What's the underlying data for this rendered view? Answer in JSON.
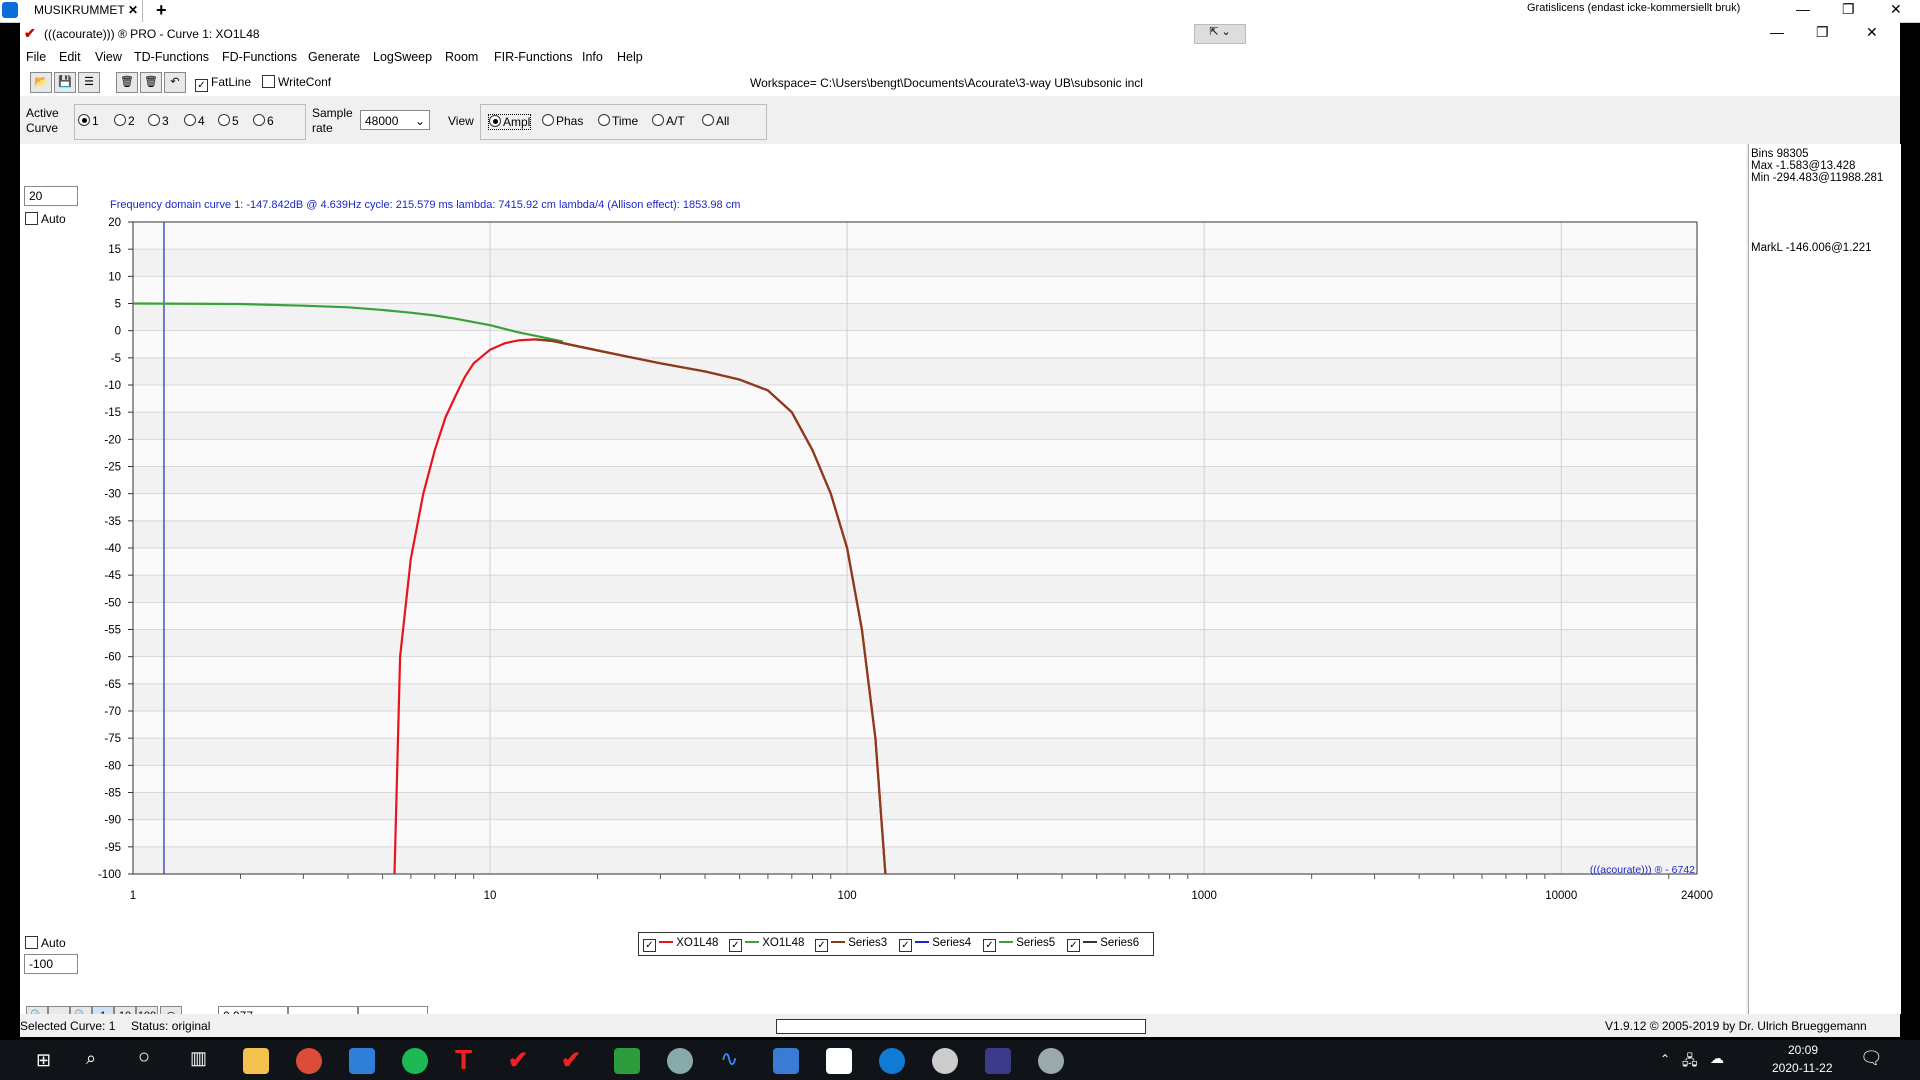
{
  "tv": {
    "tab_label": "MUSIKRUMMET",
    "license": "Gratislicens (endast icke-kommersiellt bruk)"
  },
  "app": {
    "title": "(((acourate))) ® PRO - Curve 1: XO1L48",
    "menu": [
      "File",
      "Edit",
      "View",
      "TD-Functions",
      "FD-Functions",
      "Generate",
      "LogSweep",
      "Room",
      "FIR-Functions",
      "Info",
      "Help"
    ],
    "fatline_label": "FatLine",
    "writeconf_label": "WriteConf",
    "workspace": "Workspace= C:\\Users\\bengt\\Documents\\Acourate\\3-way UB\\subsonic incl",
    "active_curve_label": "Active Curve",
    "curves": [
      "1",
      "2",
      "3",
      "4",
      "5",
      "6"
    ],
    "sample_rate_label": "Sample rate",
    "sample_rate": "48000",
    "view_label": "View",
    "views": [
      "Ampl",
      "Phas",
      "Time",
      "A/T",
      "All"
    ],
    "ymax_input": "20",
    "ymin_input": "-100",
    "auto_label": "Auto",
    "zoom_value": "0.977",
    "zoom_btns": [
      "1",
      "10",
      "100"
    ]
  },
  "info_panel": {
    "bins": "Bins 98305",
    "max": "Max -1.583@13.428",
    "min": "Min -294.483@11988.281",
    "markl": "MarkL -146.006@1.221"
  },
  "plot_header": "Frequency domain curve 1:  -147.842dB @ 4.639Hz    cycle: 215.579 ms    lambda: 7415.92 cm  lambda/4 (Allison effect): 1853.98 cm",
  "watermark": "(((acourate))) ® - 6742",
  "status": {
    "selected": "Selected Curve: 1",
    "state": "Status: original",
    "version": "V1.9.12 © 2005-2019 by Dr. Ulrich Brueggemann"
  },
  "taskbar": {
    "time": "20:09",
    "date": "2020-11-22"
  },
  "colors": {
    "red": "#e8141c",
    "green": "#3aa13a",
    "brown": "#8b3a1a",
    "blue": "#1a28c8"
  },
  "chart_data": {
    "type": "line",
    "xscale": "log",
    "xlim": [
      1,
      24000
    ],
    "ylim": [
      -100,
      20
    ],
    "x_ticks": [
      "1",
      "10",
      "100",
      "1000",
      "10000",
      "24000"
    ],
    "y_ticks": [
      20,
      15,
      10,
      5,
      0,
      -5,
      -10,
      -15,
      -20,
      -25,
      -30,
      -35,
      -40,
      -45,
      -50,
      -55,
      -60,
      -65,
      -70,
      -75,
      -80,
      -85,
      -90,
      -95,
      -100
    ],
    "marker_x": 1.221,
    "series": [
      {
        "name": "XO1L48",
        "color": "#e8141c",
        "x": [
          5.4,
          5.6,
          6,
          6.5,
          7,
          7.5,
          8,
          8.5,
          9,
          10,
          11,
          12,
          13.4,
          15,
          18,
          22,
          30,
          40,
          50,
          60,
          70,
          80,
          90,
          100,
          110,
          120,
          128
        ],
        "y": [
          -100,
          -60,
          -42,
          -30,
          -22,
          -16,
          -12,
          -8.5,
          -6,
          -3.5,
          -2.3,
          -1.8,
          -1.6,
          -1.9,
          -3,
          -4.2,
          -6,
          -7.5,
          -9,
          -11,
          -15,
          -22,
          -30,
          -40,
          -55,
          -75,
          -100
        ]
      },
      {
        "name": "XO1L48",
        "color": "#3aa13a",
        "x": [
          1,
          2,
          3,
          4,
          5,
          6,
          7,
          8,
          10,
          12,
          14,
          16
        ],
        "y": [
          5,
          4.9,
          4.6,
          4.3,
          3.8,
          3.3,
          2.8,
          2.2,
          1,
          -0.3,
          -1.2,
          -2
        ]
      },
      {
        "name": "Series3",
        "color": "#8b3a1a",
        "x": [
          13.4,
          15,
          18,
          22,
          30,
          40,
          50,
          60,
          70,
          80,
          90,
          100,
          110,
          120,
          128
        ],
        "y": [
          -1.6,
          -1.9,
          -3,
          -4.2,
          -6,
          -7.5,
          -9,
          -11,
          -15,
          -22,
          -30,
          -40,
          -55,
          -75,
          -100
        ]
      },
      {
        "name": "Series4",
        "color": "#1a28c8",
        "x": [],
        "y": []
      },
      {
        "name": "Series5",
        "color": "#3aa13a",
        "x": [],
        "y": []
      },
      {
        "name": "Series6",
        "color": "#333333",
        "x": [],
        "y": []
      }
    ]
  }
}
